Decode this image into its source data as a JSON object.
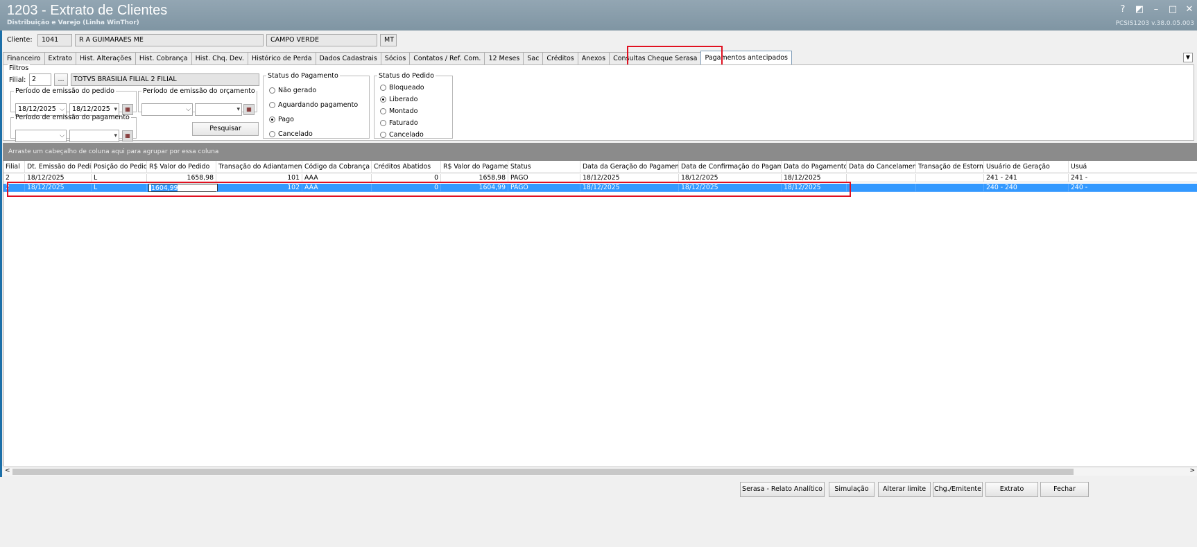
{
  "window": {
    "title": "1203 - Extrato de Clientes",
    "subtitle": "Distribuição e Varejo (Linha WinThor)",
    "version": "PCSIS1203  v.38.0.05.003",
    "controls": [
      "?",
      "◩",
      "–",
      "□",
      "✕"
    ]
  },
  "client": {
    "label": "Cliente:",
    "code": "1041",
    "name": "R A GUIMARAES ME",
    "city": "CAMPO VERDE",
    "state": "MT"
  },
  "tabs": [
    "Financeiro",
    "Extrato",
    "Hist. Alterações",
    "Hist. Cobrança",
    "Hist. Chq. Dev.",
    "Histórico de Perda",
    "Dados Cadastrais",
    "Sócios",
    "Contatos / Ref. Com.",
    "12 Meses",
    "Sac",
    "Créditos",
    "Anexos",
    "Consultas Cheque Serasa",
    "Pagamentos antecipados"
  ],
  "active_tab": "Pagamentos antecipados",
  "filters": {
    "legend": "Filtros",
    "filial_label": "Filial:",
    "filial_value": "2",
    "filial_lookup": "...",
    "filial_name": "TOTVS BRASILIA FILIAL 2 FILIAL",
    "periodo_pedido": {
      "legend": "Período de emissão do pedido",
      "from": "18/12/2025",
      "to": "18/12/2025"
    },
    "periodo_orcamento": {
      "legend": "Período de emissão do orçamento",
      "from": "",
      "to": ""
    },
    "periodo_pagamento": {
      "legend": "Período de emissão do pagamento",
      "from": "",
      "to": ""
    },
    "search_button": "Pesquisar",
    "status_pagamento": {
      "legend": "Status do Pagamento",
      "options": [
        "Não gerado",
        "Aguardando pagamento",
        "Pago",
        "Cancelado"
      ],
      "selected": "Pago"
    },
    "status_pedido": {
      "legend": "Status do Pedido",
      "options": [
        "Bloqueado",
        "Liberado",
        "Montado",
        "Faturado",
        "Cancelado"
      ],
      "selected": "Liberado"
    }
  },
  "grid": {
    "group_hint": "Arraste um cabeçalho de coluna aqui para agrupar por essa coluna",
    "columns": [
      "Filial",
      "Dt. Emissão do Pedido",
      "Posição do Pedido",
      "R$ Valor do Pedido",
      "Transação do Adiantamento",
      "Código da Cobrança",
      "Créditos Abatidos",
      "R$ Valor do Pagamento",
      "Status",
      "Data da Geração do Pagamento",
      "Data de Confirmação do Pagamento",
      "Data do Pagamento",
      "Data do Cancelamento",
      "Transação de Estorno",
      "Usuário de Geração",
      "Usuá"
    ],
    "rows": [
      [
        "2",
        "18/12/2025",
        "L",
        "1658,98",
        "101",
        "AAA",
        "0",
        "1658,98",
        "PAGO",
        "18/12/2025",
        "18/12/2025",
        "18/12/2025",
        "",
        "",
        "241 - 241",
        "241 -"
      ],
      [
        "2",
        "18/12/2025",
        "L",
        "1604,99",
        "102",
        "AAA",
        "0",
        "1604,99",
        "PAGO",
        "18/12/2025",
        "18/12/2025",
        "18/12/2025",
        "",
        "",
        "240 - 240",
        "240 -"
      ]
    ],
    "selected_row": 1
  },
  "buttons": {
    "serasa": "Serasa - Relato Analítico",
    "simulacao": "Simulação",
    "alterar_limite": "Alterar limite",
    "chg_emitente": "Chg./Emitente",
    "extrato": "Extrato",
    "fechar": "Fechar"
  },
  "colors": {
    "titlebar": "#8a9eac",
    "selection": "#3399ff",
    "highlight": "#e01020",
    "groupbar": "#8b8b8b"
  }
}
